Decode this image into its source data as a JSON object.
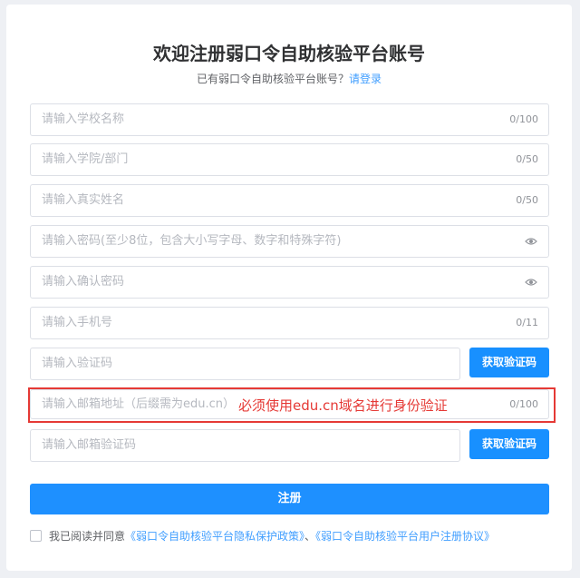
{
  "header": {
    "title": "欢迎注册弱口令自助核验平台账号",
    "have_account": "已有弱口令自助核验平台账号？",
    "login_link": "请登录"
  },
  "fields": {
    "school": {
      "placeholder": "请输入学校名称",
      "count": "0/100"
    },
    "college": {
      "placeholder": "请输入学院/部门",
      "count": "0/50"
    },
    "name": {
      "placeholder": "请输入真实姓名",
      "count": "0/50"
    },
    "password": {
      "placeholder": "请输入密码(至少8位，包含大小写字母、数字和特殊字符)"
    },
    "confirm_password": {
      "placeholder": "请输入确认密码"
    },
    "phone": {
      "placeholder": "请输入手机号",
      "count": "0/11"
    },
    "sms_code": {
      "placeholder": "请输入验证码",
      "button": "获取验证码"
    },
    "email": {
      "placeholder": "请输入邮箱地址（后缀需为edu.cn）",
      "count": "0/100"
    },
    "email_code": {
      "placeholder": "请输入邮箱验证码",
      "button": "获取验证码"
    }
  },
  "annotation": {
    "note": "必须使用edu.cn域名进行身份验证",
    "color": "#e53935"
  },
  "register_button": "注册",
  "agreement": {
    "prefix": "我已阅读并同意",
    "privacy_link": "《弱口令自助核验平台隐私保护政策》",
    "separator": "、",
    "terms_link": "《弱口令自助核验平台用户注册协议》"
  },
  "colors": {
    "primary": "#1890ff",
    "link": "#409eff"
  }
}
